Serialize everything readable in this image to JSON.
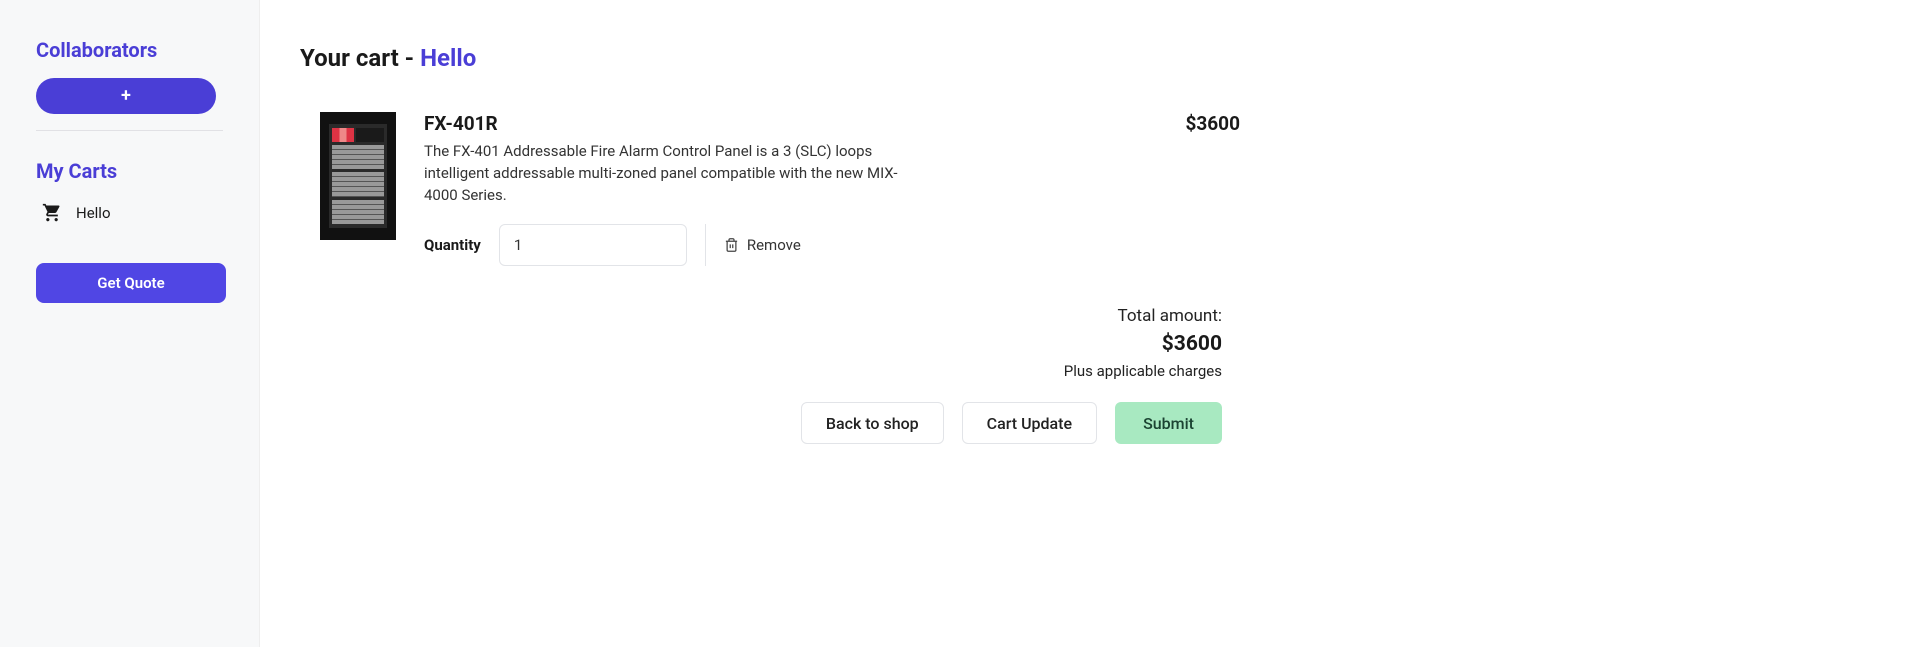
{
  "sidebar": {
    "collaborators_heading": "Collaborators",
    "add_collaborator_label": "+",
    "my_carts_heading": "My Carts",
    "cart_items": [
      {
        "label": "Hello"
      }
    ],
    "get_quote_label": "Get Quote"
  },
  "header": {
    "title_prefix": "Your cart - ",
    "cart_name": "Hello"
  },
  "cart": {
    "items": [
      {
        "name": "FX-401R",
        "description": "The FX-401 Addressable Fire Alarm Control Panel is a 3 (SLC) loops intelligent addressable multi-zoned panel compatible with the new MIX-4000 Series.",
        "price": "$3600",
        "quantity_label": "Quantity",
        "quantity_value": "1",
        "remove_label": "Remove"
      }
    ],
    "summary": {
      "total_label": "Total amount:",
      "total_value": "$3600",
      "charges_note": "Plus applicable charges"
    },
    "actions": {
      "back_label": "Back to shop",
      "update_label": "Cart Update",
      "submit_label": "Submit"
    }
  }
}
